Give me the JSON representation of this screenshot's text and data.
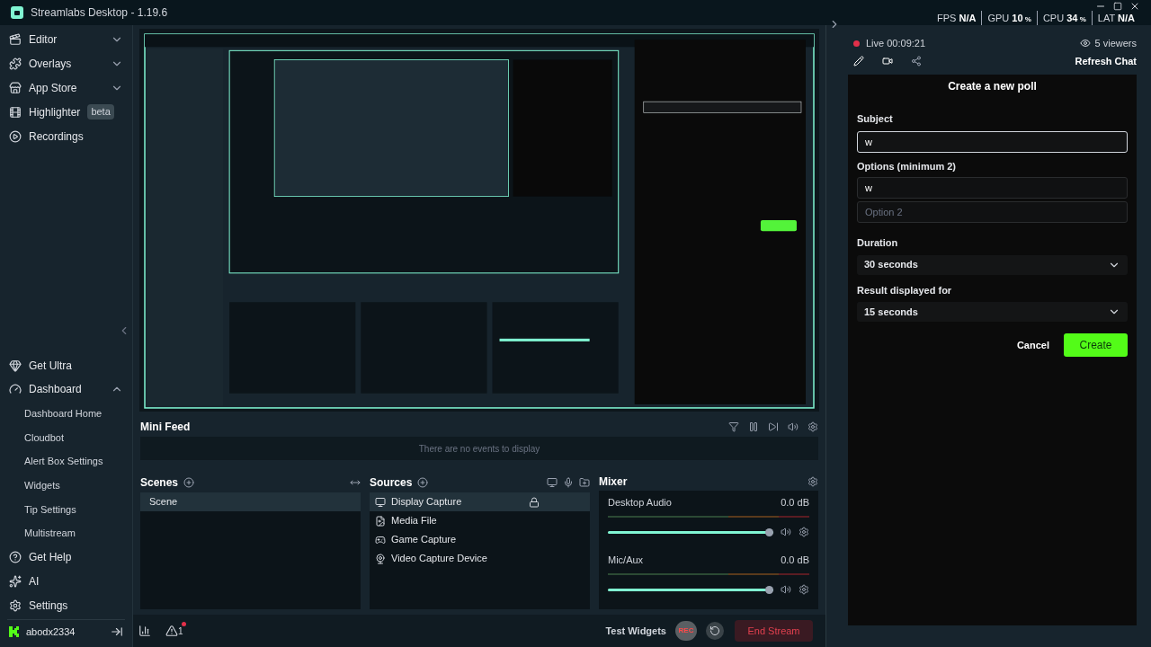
{
  "window": {
    "title": "Streamlabs Desktop - 1.19.6"
  },
  "stats": [
    {
      "label": "FPS",
      "value": "N/A"
    },
    {
      "label": "GPU",
      "value": "10",
      "unit": "%"
    },
    {
      "label": "CPU",
      "value": "34",
      "unit": "%"
    },
    {
      "label": "LAT",
      "value": "N/A"
    }
  ],
  "sidebar": {
    "top_items": [
      {
        "label": "Editor",
        "expanded": false
      },
      {
        "label": "Overlays",
        "expanded": false
      },
      {
        "label": "App Store",
        "expanded": false
      },
      {
        "label": "Highlighter",
        "badge": "beta"
      },
      {
        "label": "Recordings"
      }
    ],
    "bottom_items": [
      {
        "label": "Get Ultra"
      },
      {
        "label": "Dashboard",
        "expanded": true,
        "children": [
          {
            "label": "Dashboard Home"
          },
          {
            "label": "Cloudbot"
          },
          {
            "label": "Alert Box Settings"
          },
          {
            "label": "Widgets"
          },
          {
            "label": "Tip Settings"
          },
          {
            "label": "Multistream"
          }
        ]
      },
      {
        "label": "Get Help"
      },
      {
        "label": "AI"
      },
      {
        "label": "Settings"
      }
    ],
    "user": "abodx2334"
  },
  "mini_feed": {
    "title": "Mini Feed",
    "empty_text": "There are no events to display"
  },
  "scenes": {
    "title": "Scenes",
    "items": [
      {
        "label": "Scene",
        "selected": true
      }
    ]
  },
  "sources": {
    "title": "Sources",
    "items": [
      {
        "label": "Display Capture",
        "selected": true,
        "locked": true
      },
      {
        "label": "Media File",
        "selected": false,
        "locked": false
      },
      {
        "label": "Game Capture",
        "selected": false,
        "locked": false
      },
      {
        "label": "Video Capture Device",
        "selected": false,
        "locked": false
      }
    ]
  },
  "mixer": {
    "title": "Mixer",
    "channels": [
      {
        "name": "Desktop Audio",
        "reading": "0.0 dB",
        "level": 1
      },
      {
        "name": "Mic/Aux",
        "reading": "0.0 dB",
        "level": 1
      }
    ]
  },
  "footer": {
    "alerts": "1",
    "test_widgets": "Test Widgets",
    "rec": "REC",
    "end_stream": "End Stream"
  },
  "live": {
    "status": "Live",
    "time": "00:09:21",
    "viewers": "5 viewers",
    "refresh": "Refresh Chat"
  },
  "poll": {
    "title": "Create a new poll",
    "subject_label": "Subject",
    "subject_value": "w",
    "options_label": "Options (minimum 2)",
    "options": [
      {
        "value": "w"
      },
      {
        "placeholder": "Option 2"
      }
    ],
    "duration_label": "Duration",
    "duration": "30 seconds",
    "result_label": "Result displayed for",
    "result": "15 seconds",
    "cancel": "Cancel",
    "create": "Create"
  }
}
